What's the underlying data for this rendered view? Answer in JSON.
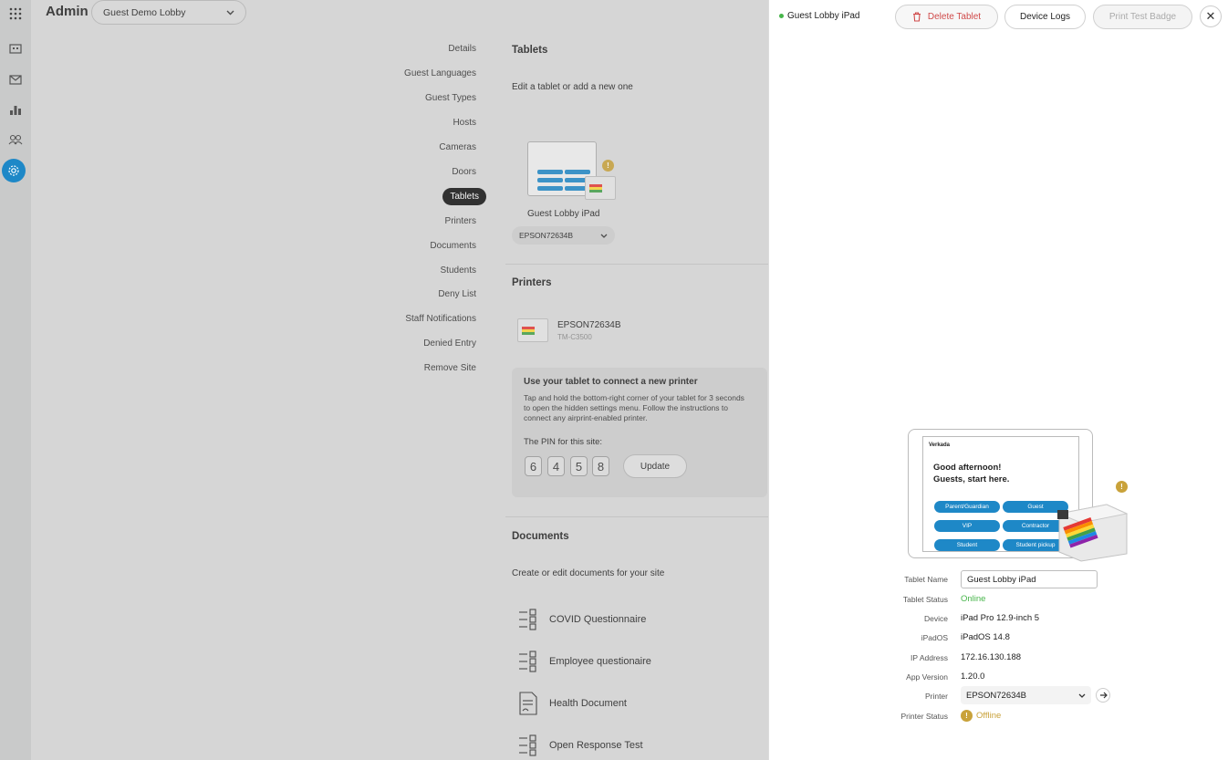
{
  "header": {
    "title": "Admin",
    "site": "Guest Demo Lobby"
  },
  "rail": {
    "icons": [
      "grid-icon",
      "building-icon",
      "mail-icon",
      "chart-icon",
      "people-icon",
      "settings-icon"
    ]
  },
  "nav": {
    "items": [
      "Details",
      "Guest Languages",
      "Guest Types",
      "Hosts",
      "Cameras",
      "Doors",
      "Tablets",
      "Printers",
      "Documents",
      "Students",
      "Deny List",
      "Staff Notifications",
      "Denied Entry",
      "Remove Site"
    ],
    "active": "Tablets"
  },
  "tablets": {
    "heading": "Tablets",
    "subtitle": "Edit a tablet or add a new one",
    "card": {
      "name": "Guest Lobby iPad",
      "printer": "EPSON72634B"
    }
  },
  "printers": {
    "heading": "Printers",
    "item": {
      "name": "EPSON72634B",
      "model": "TM-C3500"
    },
    "connect": {
      "title": "Use your tablet to connect a new printer",
      "text": "Tap and hold the bottom-right corner of your tablet for 3 seconds to open the hidden settings menu. Follow the instructions to connect any airprint-enabled printer.",
      "pin_label": "The PIN for this site:",
      "pin": [
        "6",
        "4",
        "5",
        "8"
      ],
      "update": "Update"
    }
  },
  "documents": {
    "heading": "Documents",
    "subtitle": "Create or edit documents for your site",
    "items": [
      "COVID Questionnaire",
      "Employee questionaire",
      "Health Document",
      "Open Response Test"
    ]
  },
  "panel": {
    "title": "Guest Lobby iPad",
    "delete": "Delete Tablet",
    "logs": "Device Logs",
    "test": "Print Test Badge",
    "close": "✕",
    "preview": {
      "logo": "Verkada",
      "greeting_1": "Good afternoon!",
      "greeting_2": "Guests, start here.",
      "buttons": [
        "Parent/Guardian",
        "Guest",
        "VIP",
        "Contractor",
        "Student",
        "Student pickup"
      ]
    },
    "fields": {
      "name_label": "Tablet Name",
      "name_value": "Guest Lobby iPad",
      "status_label": "Tablet Status",
      "status_value": "Online",
      "device_label": "Device",
      "device_value": "iPad Pro 12.9-inch 5",
      "os_label": "iPadOS",
      "os_value": "iPadOS 14.8",
      "ip_label": "IP Address",
      "ip_value": "172.16.130.188",
      "app_label": "App Version",
      "app_value": "1.20.0",
      "printer_label": "Printer",
      "printer_value": "EPSON72634B",
      "printer_status_label": "Printer Status",
      "printer_status_value": "Offline"
    },
    "colors": {
      "online": "#47b54a",
      "offline": "#c9a23a",
      "delete": "#d04a4a",
      "accent": "#1e88c7"
    }
  }
}
